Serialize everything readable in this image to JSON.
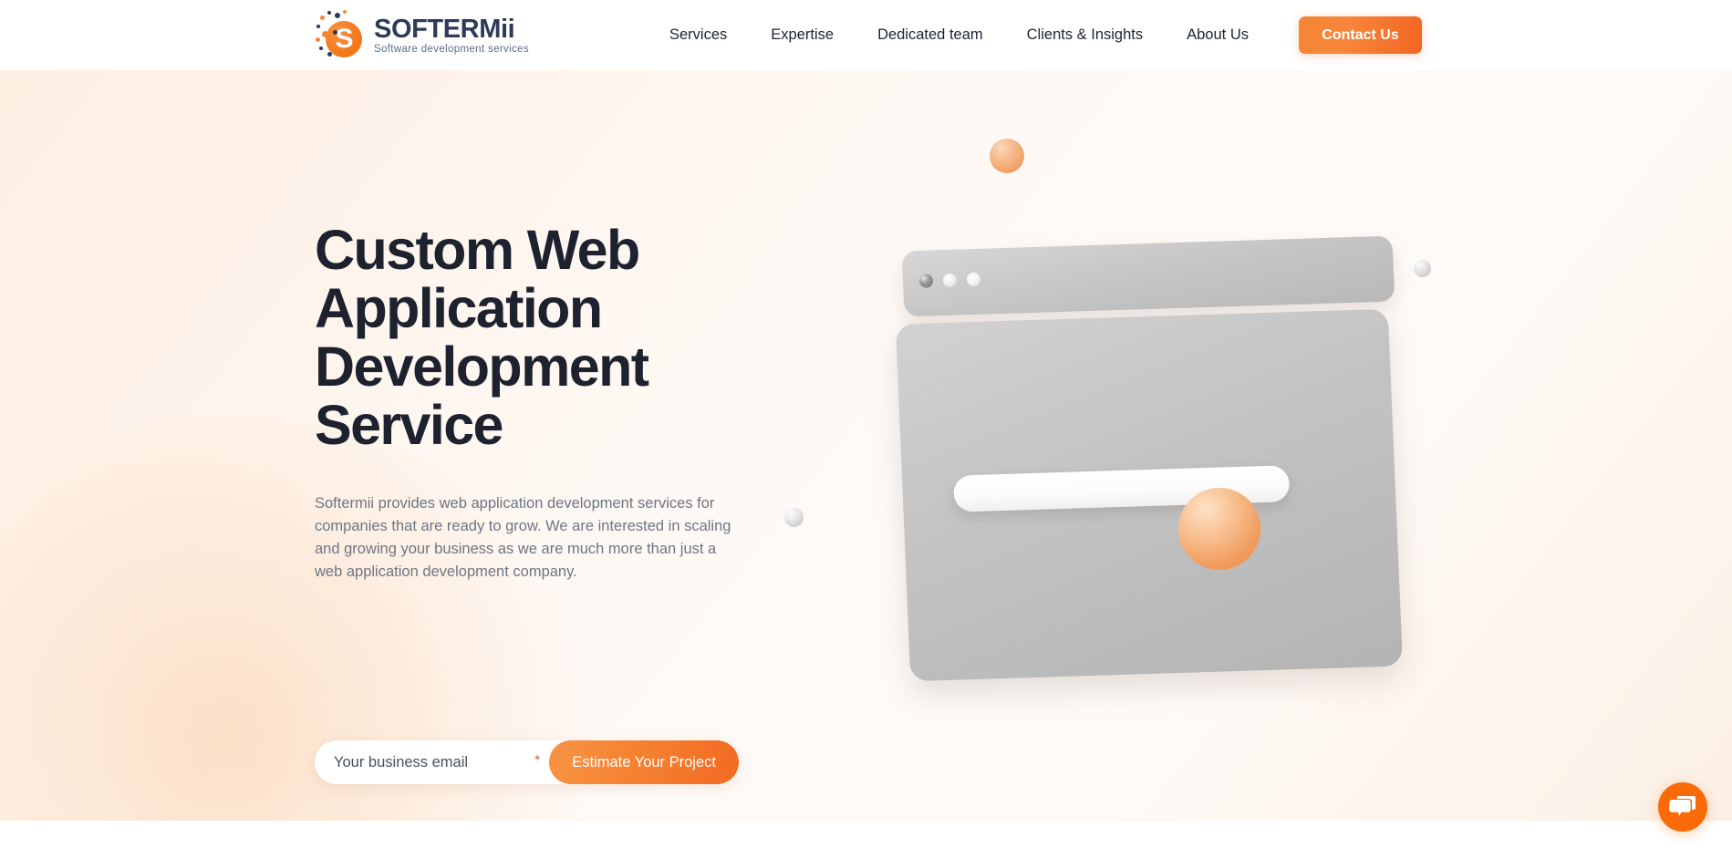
{
  "header": {
    "logo": {
      "name": "SOFTERMii",
      "tagline": "Software development services",
      "mark_letter": "S",
      "brand_orange": "#f47b20",
      "brand_navy": "#2e3a59"
    },
    "nav_items": [
      {
        "label": "Services"
      },
      {
        "label": "Expertise"
      },
      {
        "label": "Dedicated team"
      },
      {
        "label": "Clients & Insights"
      },
      {
        "label": "About Us"
      }
    ],
    "cta": {
      "label": "Contact Us",
      "color": "#f26522"
    }
  },
  "hero": {
    "title": "Custom Web Application Development Service",
    "description": "Softermii provides web application development services for companies that are ready to grow. We are interested in scaling and growing your business as we are much more than just a web application development company.",
    "form": {
      "email_placeholder": "Your business email",
      "required_marker": "*",
      "submit_label": "Estimate Your Project"
    },
    "illustration": {
      "type": "3d-browser-window",
      "window_dots": 3,
      "accent_sphere_color": "#f09e5e",
      "panel_color": "#c4c4c4"
    },
    "background_gradient": [
      "#fdeee2",
      "#fefaf7",
      "#fcefe3"
    ]
  },
  "widgets": {
    "chat": {
      "name": "chat-bubble",
      "color": "#f96a09"
    }
  }
}
